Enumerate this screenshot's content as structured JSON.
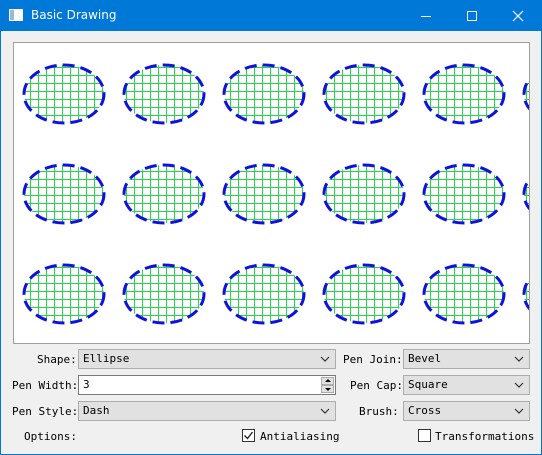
{
  "window": {
    "title": "Basic Drawing",
    "controls": {
      "minimize_icon": "minimize-icon",
      "maximize_icon": "maximize-icon",
      "close_icon": "close-icon"
    }
  },
  "canvas": {
    "shape": "ellipse",
    "rows": 3,
    "columns_visible": 6,
    "pen_color": "#1010e0",
    "brush_color": "#22d84a",
    "fill_background": "#ffffff"
  },
  "form": {
    "shape": {
      "label": "Shape:",
      "value": "Ellipse"
    },
    "pen_width": {
      "label": "Pen Width:",
      "value": "3"
    },
    "pen_style": {
      "label": "Pen Style:",
      "value": "Dash"
    },
    "pen_join": {
      "label": "Pen Join:",
      "value": "Bevel"
    },
    "pen_cap": {
      "label": "Pen Cap:",
      "value": "Square"
    },
    "brush": {
      "label": "Brush:",
      "value": "Cross"
    },
    "options_label": "Options:",
    "antialiasing": {
      "label": "Antialiasing",
      "checked": true
    },
    "transformations": {
      "label": "Transformations",
      "checked": false
    }
  }
}
